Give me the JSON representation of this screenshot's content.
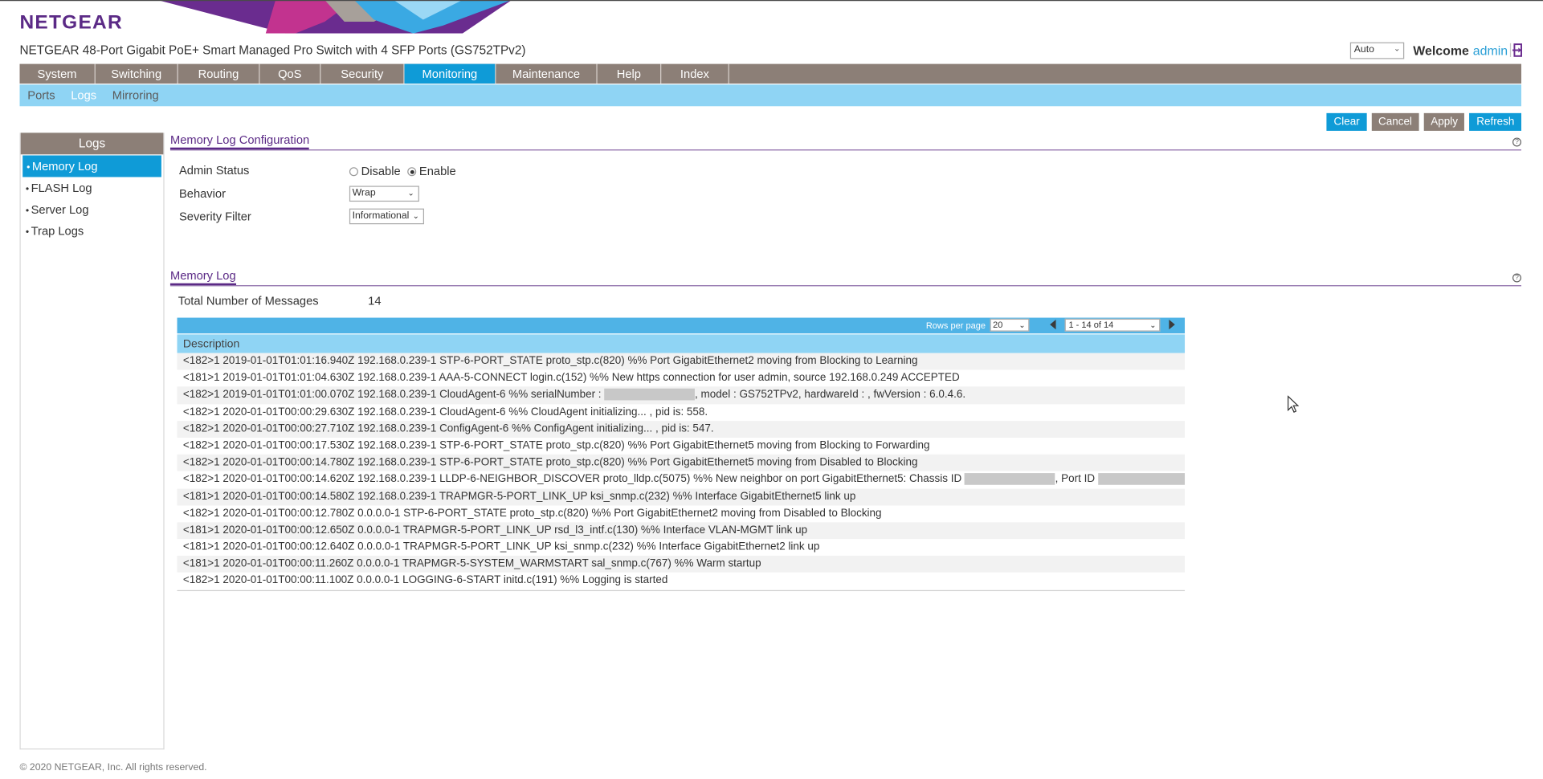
{
  "brand": {
    "logo_text": "NETGEAR",
    "product_title": "NETGEAR 48-Port Gigabit PoE+ Smart Managed Pro Switch with 4 SFP Ports (GS752TPv2)",
    "colors": {
      "purple": "#5b2a86",
      "blue": "#0f9bd7",
      "taupe": "#8c7f77",
      "light_blue": "#8fd4f4"
    }
  },
  "header": {
    "language_value": "Auto",
    "welcome_label": "Welcome",
    "username": "admin",
    "logout_icon": "logout-icon"
  },
  "nav": {
    "tabs": [
      {
        "label": "System"
      },
      {
        "label": "Switching"
      },
      {
        "label": "Routing"
      },
      {
        "label": "QoS"
      },
      {
        "label": "Security"
      },
      {
        "label": "Monitoring"
      },
      {
        "label": "Maintenance"
      },
      {
        "label": "Help"
      },
      {
        "label": "Index"
      }
    ],
    "active": "Monitoring"
  },
  "subnav": {
    "items": [
      {
        "label": "Ports"
      },
      {
        "label": "Logs"
      },
      {
        "label": "Mirroring"
      }
    ],
    "active": "Logs"
  },
  "toolbar": {
    "clear_label": "Clear",
    "cancel_label": "Cancel",
    "apply_label": "Apply",
    "refresh_label": "Refresh"
  },
  "sidebar": {
    "title": "Logs",
    "items": [
      {
        "label": "Memory Log"
      },
      {
        "label": "FLASH Log"
      },
      {
        "label": "Server Log"
      },
      {
        "label": "Trap Logs"
      }
    ],
    "active": "Memory Log"
  },
  "config": {
    "title": "Memory Log Configuration",
    "admin_status_label": "Admin Status",
    "disable_label": "Disable",
    "enable_label": "Enable",
    "admin_status_value": "Enable",
    "behavior_label": "Behavior",
    "behavior_value": "Wrap",
    "severity_label": "Severity Filter",
    "severity_value": "Informational"
  },
  "memory_log": {
    "title": "Memory Log",
    "total_label": "Total Number of Messages",
    "total_value": "14",
    "rows_per_page_label": "Rows per page",
    "rows_per_page_value": "20",
    "range_value": "1 - 14 of 14",
    "column_header": "Description",
    "rows": [
      "<182>1 2019-01-01T01:01:16.940Z 192.168.0.239-1 STP-6-PORT_STATE proto_stp.c(820) %% Port GigabitEthernet2 moving from Blocking to Learning",
      "<181>1 2019-01-01T01:01:04.630Z 192.168.0.239-1 AAA-5-CONNECT login.c(152) %% New https connection for user admin, source 192.168.0.249 ACCEPTED",
      "<182>1 2019-01-01T01:01:00.070Z 192.168.0.239-1 CloudAgent-6 %% serialNumber : ",
      "<182>1 2020-01-01T00:00:29.630Z 192.168.0.239-1 CloudAgent-6 %% CloudAgent initializing... , pid is: 558.",
      "<182>1 2020-01-01T00:00:27.710Z 192.168.0.239-1 ConfigAgent-6 %% ConfigAgent initializing... , pid is: 547.",
      "<182>1 2020-01-01T00:00:17.530Z 192.168.0.239-1 STP-6-PORT_STATE proto_stp.c(820) %% Port GigabitEthernet5 moving from Blocking to Forwarding",
      "<182>1 2020-01-01T00:00:14.780Z 192.168.0.239-1 STP-6-PORT_STATE proto_stp.c(820) %% Port GigabitEthernet5 moving from Disabled to Blocking",
      "<182>1 2020-01-01T00:00:14.620Z 192.168.0.239-1 LLDP-6-NEIGHBOR_DISCOVER proto_lldp.c(5075) %% New neighbor on port GigabitEthernet5: Chassis ID ",
      "<181>1 2020-01-01T00:00:14.580Z 192.168.0.239-1 TRAPMGR-5-PORT_LINK_UP ksi_snmp.c(232) %% Interface GigabitEthernet5 link up",
      "<182>1 2020-01-01T00:00:12.780Z 0.0.0.0-1 STP-6-PORT_STATE proto_stp.c(820) %% Port GigabitEthernet2 moving from Disabled to Blocking",
      "<181>1 2020-01-01T00:00:12.650Z 0.0.0.0-1 TRAPMGR-5-PORT_LINK_UP rsd_l3_intf.c(130) %% Interface VLAN-MGMT link up",
      "<181>1 2020-01-01T00:00:12.640Z 0.0.0.0-1 TRAPMGR-5-PORT_LINK_UP ksi_snmp.c(232) %% Interface GigabitEthernet2 link up",
      "<181>1 2020-01-01T00:00:11.260Z 0.0.0.0-1 TRAPMGR-5-SYSTEM_WARMSTART sal_snmp.c(767) %% Warm startup",
      "<182>1 2020-01-01T00:00:11.100Z 0.0.0.0-1 LOGGING-6-START initd.c(191) %% Logging is started"
    ],
    "row3_tail": ", model : GS752TPv2, hardwareId : , fwVersion : 6.0.4.6.",
    "row8_tail": ", Port ID "
  },
  "footer": {
    "copyright": "© 2020 NETGEAR, Inc. All rights reserved."
  }
}
